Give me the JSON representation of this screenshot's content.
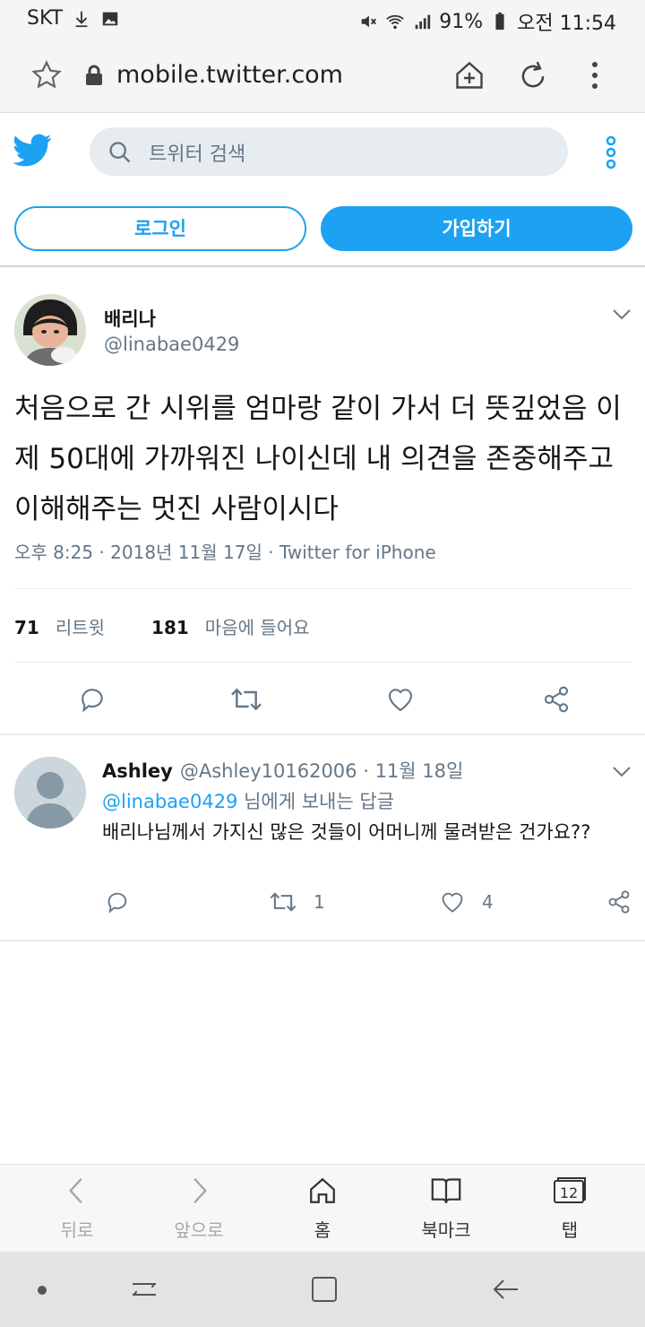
{
  "status_bar": {
    "carrier": "SKT",
    "battery": "91%",
    "time": "오전 11:54"
  },
  "browser": {
    "url": "mobile.twitter.com"
  },
  "twitter_header": {
    "search_placeholder": "트위터 검색",
    "login_label": "로그인",
    "signup_label": "가입하기",
    "brand_color": "#1da1f2"
  },
  "tweet": {
    "author_name": "배리나",
    "author_handle": "@linabae0429",
    "text": "처음으로 간 시위를 엄마랑 같이 가서 더 뜻깊었음 이제 50대에 가까워진 나이신데 내 의견을 존중해주고 이해해주는 멋진 사람이시다",
    "meta": "오후 8:25 · 2018년 11월 17일 · Twitter for iPhone",
    "retweet_count": "71",
    "retweet_label": "리트윗",
    "like_count": "181",
    "like_label": "마음에 들어요"
  },
  "reply": {
    "name": "Ashley",
    "handle": "@Ashley10162006",
    "date": "· 11월 18일",
    "reply_to_handle": "@linabae0429",
    "reply_to_suffix": " 님에게 보내는 답글",
    "text": "배리나님께서 가지신 많은 것들이 어머니께 물려받은 건가요??",
    "retweet_count": "1",
    "like_count": "4"
  },
  "browser_bar": {
    "back_label": "뒤로",
    "forward_label": "앞으로",
    "home_label": "홈",
    "bookmark_label": "북마크",
    "tabs_label": "탭",
    "tabs_count": "12"
  }
}
